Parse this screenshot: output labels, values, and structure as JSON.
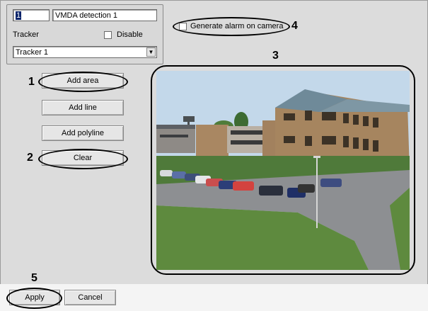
{
  "detection": {
    "id_value": "1",
    "name_value": "VMDA detection 1",
    "tracker_label": "Tracker",
    "disable_label": "Disable",
    "disable_checked": false,
    "tracker_selected": "Tracker 1"
  },
  "camera": {
    "generate_alarm_label": "Generate alarm on camera",
    "generate_alarm_checked": false
  },
  "area_buttons": {
    "add_area": "Add area",
    "add_line": "Add line",
    "add_polyline": "Add polyline",
    "clear": "Clear"
  },
  "footer": {
    "apply": "Apply",
    "cancel": "Cancel"
  },
  "callouts": {
    "c1": "1",
    "c2": "2",
    "c3": "3",
    "c4": "4",
    "c5": "5"
  },
  "icons": {
    "combo_arrow": "chevron-down-icon"
  },
  "colors": {
    "panel": "#dcdcdc",
    "selection": "#0a246a",
    "callout_outline": "#000000"
  }
}
